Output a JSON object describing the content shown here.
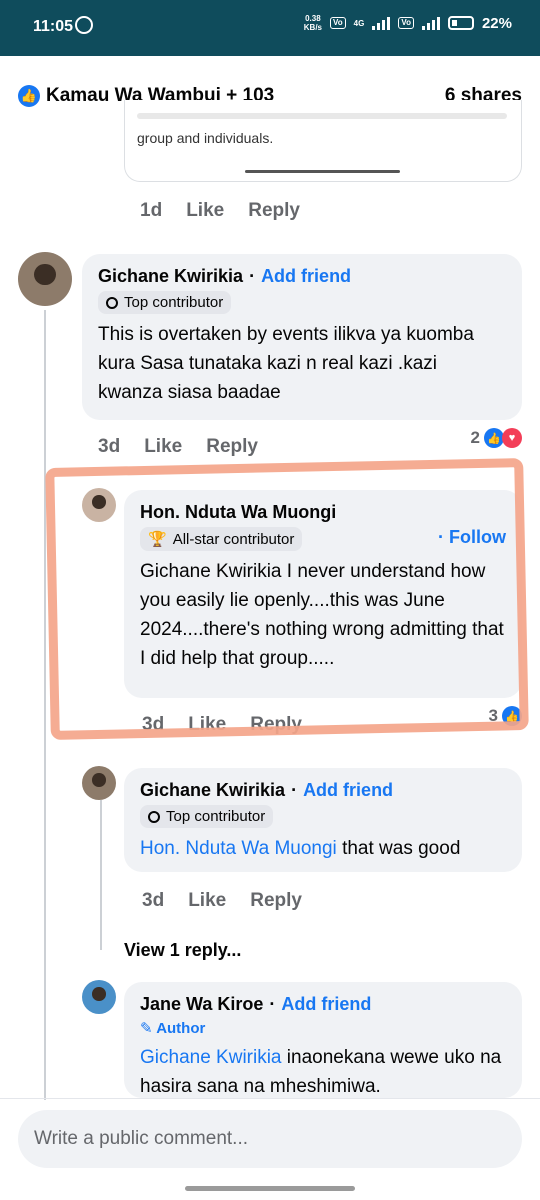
{
  "status_bar": {
    "time": "11:05",
    "net_speed_top": "0.38",
    "net_speed_bottom": "KB/s",
    "net_type": "4G",
    "battery": "22%"
  },
  "post": {
    "likes_text": "Kamau Wa Wambui + 103",
    "shares": "6 shares",
    "preview_text": "group and individuals."
  },
  "top_actions": {
    "time": "1d",
    "like": "Like",
    "reply": "Reply"
  },
  "comments": [
    {
      "name": "Gichane Kwirikia",
      "action": "Add friend",
      "badge": "Top contributor",
      "text": "This is overtaken by events ilikva ya kuomba kura Sasa tunataka kazi n real kazi .kazi kwanza siasa baadae",
      "time": "3d",
      "like": "Like",
      "reply": "Reply",
      "reaction_count": "2"
    },
    {
      "name": "Hon. Nduta Wa Muongi",
      "action": "Follow",
      "badge": "All-star contributor",
      "text": "Gichane Kwirikia I never understand how you easily lie openly....this was June 2024....there's nothing wrong admitting that I did help that group.....",
      "time": "3d",
      "like": "Like",
      "reply": "Reply",
      "reaction_count": "3"
    },
    {
      "name": "Gichane Kwirikia",
      "action": "Add friend",
      "badge": "Top contributor",
      "mention": "Hon. Nduta Wa Muongi",
      "text": " that was good",
      "time": "3d",
      "like": "Like",
      "reply": "Reply"
    },
    {
      "name": "Jane Wa Kiroe",
      "action": "Add friend",
      "badge": "Author",
      "mention": "Gichane Kwirikia",
      "text": " inaonekana wewe uko na hasira sana na mheshimiwa."
    }
  ],
  "view_replies": "View 1 reply...",
  "composer": {
    "placeholder": "Write a public comment..."
  }
}
